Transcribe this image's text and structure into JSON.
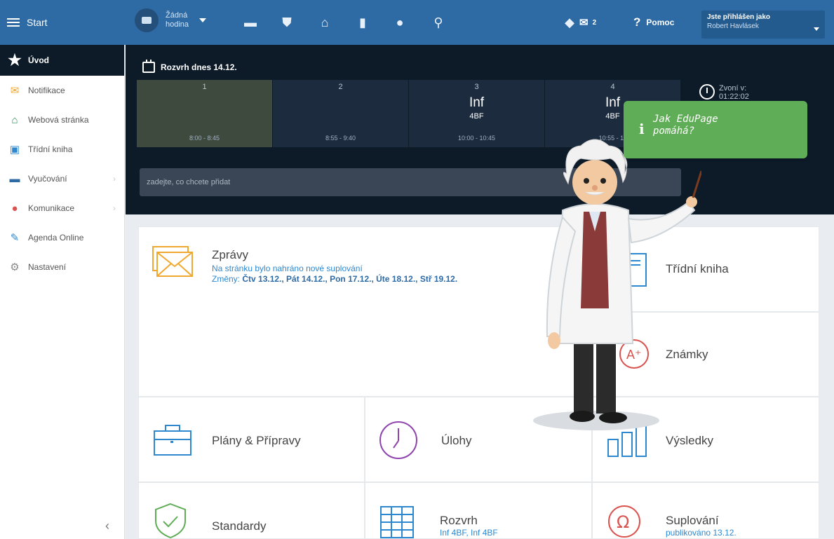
{
  "topbar": {
    "start_label": "Start",
    "hodina_label": "Žádná hodina",
    "icons": [
      "briefcase-icon",
      "shield-icon",
      "bank-icon",
      "bar-chart-icon",
      "sports-icon",
      "walk-icon"
    ],
    "chat_icon": "chat-icon",
    "mail_count": "2",
    "help_label": "Pomoc",
    "user_line1": "Jste přihlášen jako",
    "user_line2": "Robert Havlásek"
  },
  "sidebar": {
    "items": [
      {
        "label": "Úvod",
        "icon": "star-icon"
      },
      {
        "label": "Notifikace",
        "icon": "envelope-icon"
      },
      {
        "label": "Webová stránka",
        "icon": "home-icon"
      },
      {
        "label": "Třídní kniha",
        "icon": "book-icon"
      },
      {
        "label": "Vyučování",
        "icon": "briefcase-icon"
      },
      {
        "label": "Komunikace",
        "icon": "people-icon"
      },
      {
        "label": "Agenda Online",
        "icon": "pen-icon"
      },
      {
        "label": "Nastavení",
        "icon": "gear-icon"
      }
    ],
    "collapse": "‹"
  },
  "schedule": {
    "title": "Rozvrh dnes 14.12.",
    "slots": [
      {
        "num": "1",
        "subject": "",
        "room": "",
        "time": "8:00 - 8:45"
      },
      {
        "num": "2",
        "subject": "",
        "room": "",
        "time": "8:55 - 9:40"
      },
      {
        "num": "3",
        "subject": "Inf",
        "room": "4BF",
        "time": "10:00 - 10:45"
      },
      {
        "num": "4",
        "subject": "Inf",
        "room": "4BF",
        "time": "10:55 - 11"
      }
    ],
    "zvoni_label": "Zvoní v:",
    "zvoni_value": "01:22:02",
    "add_placeholder": "zadejte, co chcete přidat"
  },
  "tiles": {
    "zpravy": {
      "title": "Zprávy",
      "line1": "Na stránku bylo nahráno nové suplování",
      "line2_prefix": "Změny: ",
      "line2_dates": "Čtv 13.12., Pát 14.12., Pon 17.12., Úte 18.12., Stř 19.12."
    },
    "tridni_kniha": "Třídní kniha",
    "znamky": "Známky",
    "plany": "Plány & Přípravy",
    "ulohy": "Úlohy",
    "vysledky": "Výsledky",
    "standardy": "Standardy",
    "rozvrh": {
      "title": "Rozvrh",
      "sub": "Inf 4BF, Inf 4BF"
    },
    "suplovani": {
      "title": "Suplování",
      "sub": "publikováno 13.12."
    }
  },
  "bubble": {
    "icon": "i",
    "line1": "Jak EduPage",
    "line2": "pomáhá?"
  },
  "colors": {
    "topbar": "#2e6aa3",
    "dark_panel": "#0d1a28",
    "bubble": "#5fad56",
    "link": "#2e88d0"
  }
}
